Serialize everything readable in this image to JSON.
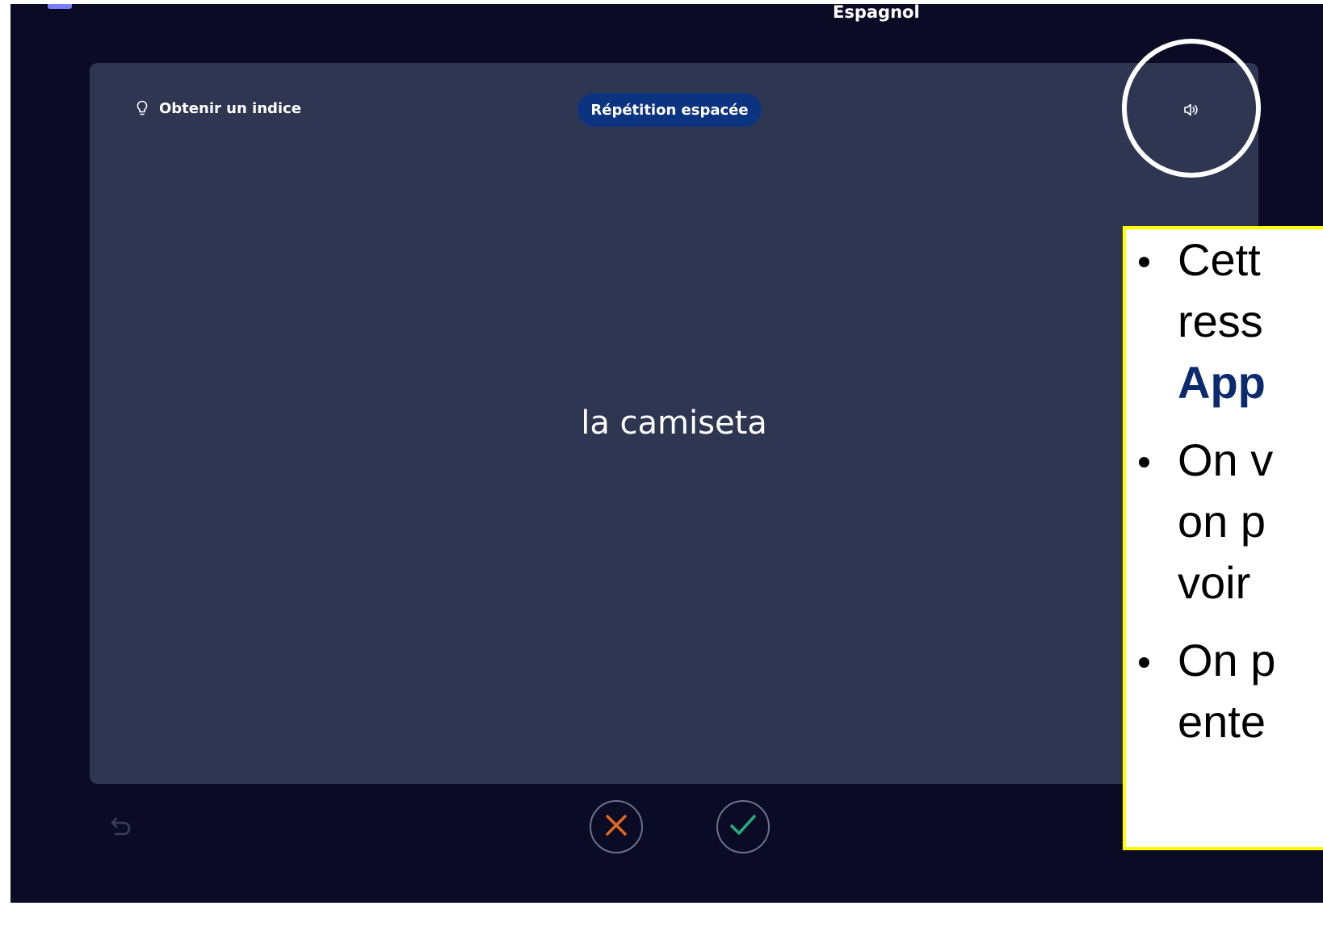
{
  "header": {
    "title": "Espagnol"
  },
  "card": {
    "hint_label": "Obtenir un indice",
    "mode_badge": "Répétition espacée",
    "term": "la camiseta",
    "audio_icon": "speaker-icon"
  },
  "controls": {
    "undo_icon": "undo-icon",
    "wrong_icon": "cross-icon",
    "right_icon": "check-icon",
    "wrong_color": "#e0691e",
    "right_color": "#22b07a"
  },
  "callout": {
    "items": [
      {
        "lines": [
          "Cett",
          "ress",
          "App"
        ]
      },
      {
        "lines": [
          "On v",
          "on p",
          "voir"
        ]
      },
      {
        "lines": [
          "On p",
          "ente"
        ]
      }
    ]
  }
}
